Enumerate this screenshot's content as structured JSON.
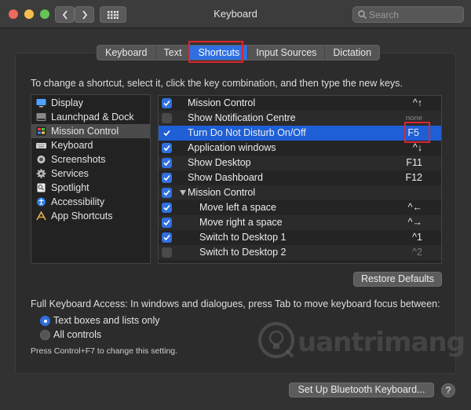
{
  "window": {
    "title": "Keyboard",
    "search_placeholder": "Search"
  },
  "tabs": [
    {
      "label": "Keyboard",
      "active": false
    },
    {
      "label": "Text",
      "active": false
    },
    {
      "label": "Shortcuts",
      "active": true
    },
    {
      "label": "Input Sources",
      "active": false
    },
    {
      "label": "Dictation",
      "active": false
    }
  ],
  "instruction": "To change a shortcut, select it, click the key combination, and then type the new keys.",
  "categories": [
    {
      "label": "Display",
      "icon": "display-icon",
      "selected": false
    },
    {
      "label": "Launchpad & Dock",
      "icon": "launchpad-icon",
      "selected": false
    },
    {
      "label": "Mission Control",
      "icon": "mission-control-icon",
      "selected": true
    },
    {
      "label": "Keyboard",
      "icon": "keyboard-icon",
      "selected": false
    },
    {
      "label": "Screenshots",
      "icon": "screenshots-icon",
      "selected": false
    },
    {
      "label": "Services",
      "icon": "gear-icon",
      "selected": false
    },
    {
      "label": "Spotlight",
      "icon": "spotlight-icon",
      "selected": false
    },
    {
      "label": "Accessibility",
      "icon": "accessibility-icon",
      "selected": false
    },
    {
      "label": "App Shortcuts",
      "icon": "app-shortcuts-icon",
      "selected": false
    }
  ],
  "shortcuts": [
    {
      "name": "Mission Control",
      "key": "^↑",
      "checked": true,
      "indent": false
    },
    {
      "name": "Show Notification Centre",
      "key": "none",
      "checked": false,
      "indent": false
    },
    {
      "name": "Turn Do Not Disturb On/Off",
      "key": "F5",
      "checked": true,
      "indent": false,
      "selected": true
    },
    {
      "name": "Application windows",
      "key": "^↓",
      "checked": true,
      "indent": false
    },
    {
      "name": "Show Desktop",
      "key": "F11",
      "checked": true,
      "indent": false
    },
    {
      "name": "Show Dashboard",
      "key": "F12",
      "checked": true,
      "indent": false
    },
    {
      "name": "Mission Control",
      "key": "",
      "checked": true,
      "indent": false,
      "group": true
    },
    {
      "name": "Move left a space",
      "key": "^←",
      "checked": true,
      "indent": true
    },
    {
      "name": "Move right a space",
      "key": "^→",
      "checked": true,
      "indent": true
    },
    {
      "name": "Switch to Desktop 1",
      "key": "^1",
      "checked": true,
      "indent": true
    },
    {
      "name": "Switch to Desktop 2",
      "key": "^2",
      "checked": false,
      "indent": true
    }
  ],
  "restore_label": "Restore Defaults",
  "full_keyboard_access": "Full Keyboard Access: In windows and dialogues, press Tab to move keyboard focus between:",
  "radio_options": [
    {
      "label": "Text boxes and lists only",
      "selected": true
    },
    {
      "label": "All controls",
      "selected": false
    }
  ],
  "hint": "Press Control+F7 to change this setting.",
  "watermark": "uantrimang",
  "bluetooth_label": "Set Up Bluetooth Keyboard...",
  "help_label": "?",
  "colors": {
    "accent": "#2f6fe0",
    "highlight": "#e0242c"
  }
}
